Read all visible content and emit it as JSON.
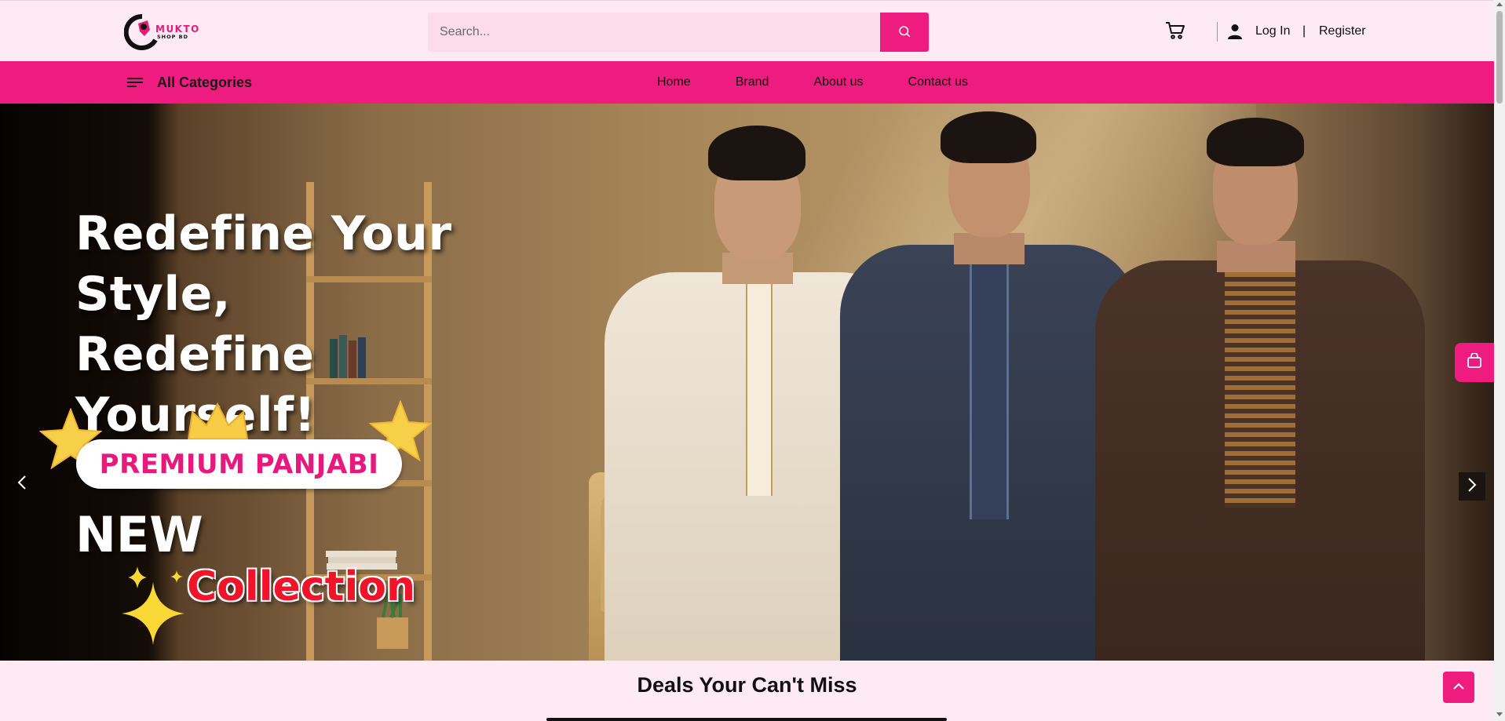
{
  "brand": {
    "logo_title": "MUKTO",
    "logo_subtitle": "SHOP BD"
  },
  "header": {
    "search_placeholder": "Search...",
    "login_label": "Log In",
    "separator": "|",
    "register_label": "Register"
  },
  "nav": {
    "categories_label": "All Categories",
    "links": [
      {
        "label": "Home"
      },
      {
        "label": "Brand"
      },
      {
        "label": "About us"
      },
      {
        "label": "Contact us"
      }
    ]
  },
  "hero": {
    "headline_line1": "Redefine Your",
    "headline_line2": "Style, Redefine",
    "headline_line3": "Yourself!",
    "badge": "PREMIUM PANJABI",
    "new_label": "NEW",
    "collection_label": "Collection"
  },
  "sections": {
    "deals_title": "Deals Your Can't Miss"
  },
  "colors": {
    "accent": "#ee1c7e",
    "page_bg": "#fdeaf3",
    "search_bg": "#fddcea"
  },
  "icons": {
    "search": "search-icon",
    "cart": "cart-icon",
    "user": "user-icon",
    "menu": "menu-icon",
    "bag": "shopping-bag-icon",
    "prev": "chevron-left-icon",
    "next": "chevron-right-icon",
    "top": "chevron-up-icon"
  }
}
